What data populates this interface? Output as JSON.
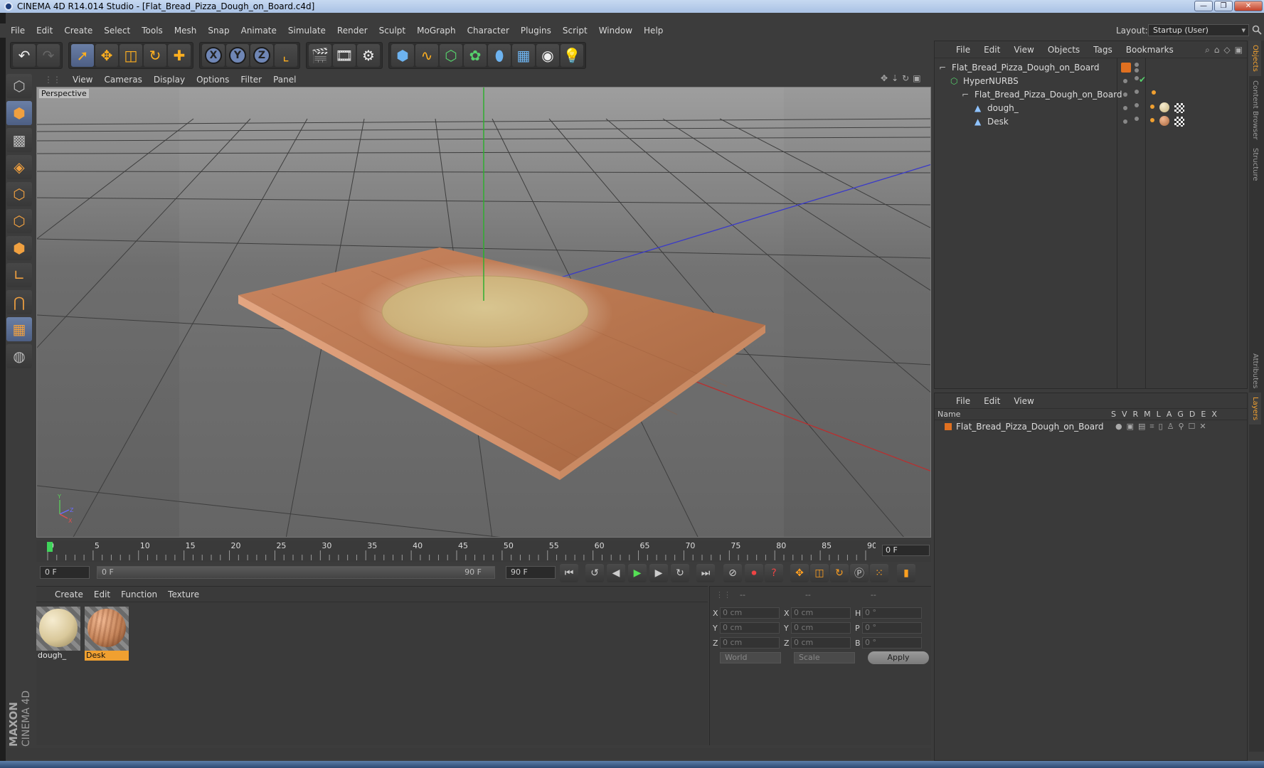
{
  "window": {
    "title": "CINEMA 4D R14.014 Studio - [Flat_Bread_Pizza_Dough_on_Board.c4d]",
    "buttons": [
      "—",
      "❐",
      "✕"
    ]
  },
  "menu": [
    "File",
    "Edit",
    "Create",
    "Select",
    "Tools",
    "Mesh",
    "Snap",
    "Animate",
    "Simulate",
    "Render",
    "Sculpt",
    "MoGraph",
    "Character",
    "Plugins",
    "Script",
    "Window",
    "Help"
  ],
  "layout": {
    "label": "Layout:",
    "value": "Startup (User)"
  },
  "toolbar": {
    "undo": "undo-icon",
    "redo": "redo-icon",
    "tools": [
      "live-selection-icon",
      "move-icon",
      "scale-icon",
      "rotate-icon",
      "add-icon"
    ],
    "axes": [
      "X",
      "Y",
      "Z"
    ],
    "coordinate_system": "world-coord-icon",
    "render": [
      "render-view-icon",
      "render-picture-viewer-icon",
      "render-settings-icon"
    ],
    "objects": [
      "cube-icon",
      "spline-icon",
      "nurbs-icon",
      "array-icon",
      "deformer-icon",
      "floor-icon",
      "camera-icon",
      "light-icon"
    ]
  },
  "viewport": {
    "menu": [
      "View",
      "Cameras",
      "Display",
      "Options",
      "Filter",
      "Panel"
    ],
    "label": "Perspective"
  },
  "timeline": {
    "ticks": [
      "0",
      "5",
      "10",
      "15",
      "20",
      "25",
      "30",
      "35",
      "40",
      "45",
      "50",
      "55",
      "60",
      "65",
      "70",
      "75",
      "80",
      "85",
      "90"
    ],
    "current_frame": "0 F"
  },
  "transport": {
    "start": "0 F",
    "range_start": "0 F",
    "range_end": "90 F",
    "end": "90 F"
  },
  "material_manager": {
    "menu": [
      "Create",
      "Edit",
      "Function",
      "Texture"
    ],
    "materials": [
      {
        "name": "dough_",
        "color": "#d9c89a",
        "selected": false
      },
      {
        "name": "Desk",
        "color": "#c4845a",
        "selected": true
      }
    ]
  },
  "coordinates": {
    "headers": [
      "--",
      "--",
      "--"
    ],
    "rows": [
      {
        "a": "X",
        "av": "0 cm",
        "b": "X",
        "bv": "0 cm",
        "c": "H",
        "cv": "0 °"
      },
      {
        "a": "Y",
        "av": "0 cm",
        "b": "Y",
        "bv": "0 cm",
        "c": "P",
        "cv": "0 °"
      },
      {
        "a": "Z",
        "av": "0 cm",
        "b": "Z",
        "bv": "0 cm",
        "c": "B",
        "cv": "0 °"
      }
    ],
    "mode1": "World",
    "mode2": "Scale",
    "apply": "Apply"
  },
  "object_manager": {
    "menu": [
      "File",
      "Edit",
      "View",
      "Objects",
      "Tags",
      "Bookmarks"
    ],
    "objects": [
      {
        "name": "Flat_Bread_Pizza_Dough_on_Board",
        "icon": "null-icon",
        "indent": 0
      },
      {
        "name": "HyperNURBS",
        "icon": "hypernurbs-icon",
        "indent": 1
      },
      {
        "name": "Flat_Bread_Pizza_Dough_on_Board",
        "icon": "null-icon",
        "indent": 2
      },
      {
        "name": "dough_",
        "icon": "polygon-icon",
        "indent": 3
      },
      {
        "name": "Desk",
        "icon": "polygon-icon",
        "indent": 3
      }
    ]
  },
  "layer_manager": {
    "menu": [
      "File",
      "Edit",
      "View"
    ],
    "header": {
      "name": "Name",
      "cols": [
        "S",
        "V",
        "R",
        "M",
        "L",
        "A",
        "G",
        "D",
        "E",
        "X"
      ]
    },
    "layers": [
      {
        "name": "Flat_Bread_Pizza_Dough_on_Board",
        "color": "#e07020"
      }
    ]
  },
  "right_tabs": [
    "Objects",
    "Content Browser",
    "Structure",
    "Attributes",
    "Layers"
  ],
  "branding": {
    "maxon": "MAXON",
    "product": "CINEMA 4D"
  },
  "colors": {
    "accent": "#f0a030",
    "selection": "#6a7fa6"
  }
}
